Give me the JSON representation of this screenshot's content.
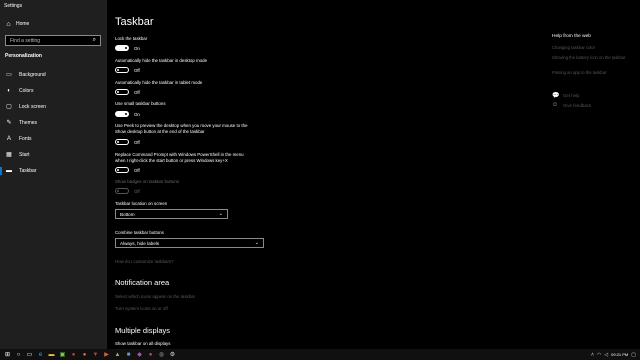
{
  "window": {
    "title": "Settings"
  },
  "sidebar": {
    "home": "Home",
    "search_placeholder": "Find a setting",
    "section": "Personalization",
    "items": [
      {
        "label": "Background",
        "icon": "image-icon"
      },
      {
        "label": "Colors",
        "icon": "palette-icon"
      },
      {
        "label": "Lock screen",
        "icon": "monitor-icon"
      },
      {
        "label": "Themes",
        "icon": "brush-icon"
      },
      {
        "label": "Fonts",
        "icon": "font-icon"
      },
      {
        "label": "Start",
        "icon": "start-icon"
      },
      {
        "label": "Taskbar",
        "icon": "taskbar-icon"
      }
    ],
    "active": "Taskbar"
  },
  "main": {
    "title": "Taskbar",
    "settings": [
      {
        "label": "Lock the taskbar",
        "state": "On",
        "on": true
      },
      {
        "label": "Automatically hide the taskbar in desktop mode",
        "state": "Off",
        "on": false
      },
      {
        "label": "Automatically hide the taskbar in tablet mode",
        "state": "Off",
        "on": false
      },
      {
        "label": "Use small taskbar buttons",
        "state": "On",
        "on": true
      },
      {
        "label1": "Use Peek to preview the desktop when you move your mouse to the",
        "label2": "Show desktop button at the end of the taskbar",
        "state": "Off",
        "on": false
      },
      {
        "label1": "Replace Command Prompt with Windows PowerShell in the menu",
        "label2": "when I right-click the start button or press Windows key+X",
        "state": "Off",
        "on": false
      },
      {
        "label": "Show badges on taskbar buttons",
        "state": "Off",
        "on": false,
        "disabled": true
      }
    ],
    "location": {
      "label": "Taskbar location on screen",
      "value": "Bottom"
    },
    "combine": {
      "label": "Combine taskbar buttons",
      "value": "Always, hide labels"
    },
    "customize_link": "How do I customize taskbars?",
    "notification": {
      "title": "Notification area",
      "link1": "Select which icons appear on the taskbar",
      "link2": "Turn system icons on or off"
    },
    "multiple": {
      "title": "Multiple displays",
      "label": "Show taskbar on all displays"
    }
  },
  "help": {
    "title": "Help from the web",
    "links": [
      "Changing taskbar color",
      "Showing the battery icon on the taskbar",
      "Pinning an app to the taskbar"
    ],
    "get_help": "Get help",
    "feedback": "Give feedback"
  },
  "taskbar": {
    "clock": "09:21 PM",
    "icons": [
      "windows-icon",
      "search-icon",
      "taskview-icon",
      "edge-icon",
      "explorer-icon",
      "store-icon",
      "chrome-icon",
      "firefox-icon",
      "mail-icon",
      "media-icon",
      "app-icon",
      "app-icon",
      "app-icon",
      "app-icon",
      "app-icon",
      "settings-icon"
    ]
  }
}
